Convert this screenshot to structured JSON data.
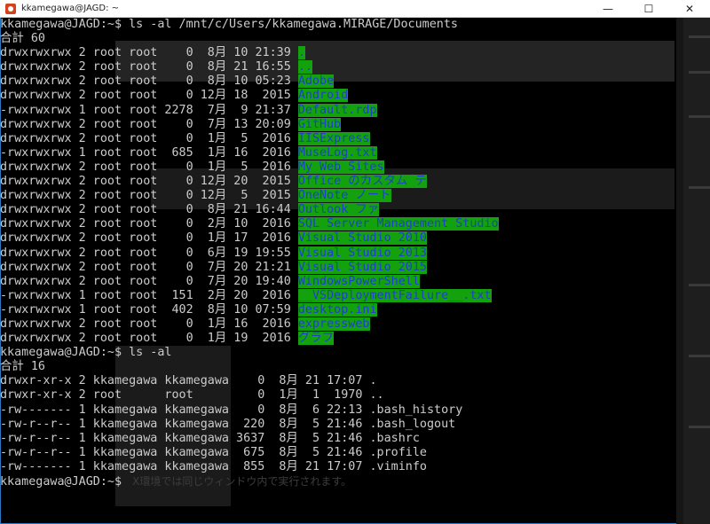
{
  "window": {
    "title": "kkamegawa@JAGD: ~",
    "controls": {
      "minimize": "—",
      "maximize": "☐",
      "close": "✕"
    }
  },
  "terminal": {
    "lines": [
      {
        "prefix": "kkamegawa@JAGD:~$ ls -al /mnt/c/Users/kkamegawa.MIRAGE/Documents",
        "name": ""
      },
      {
        "prefix": "合計 60",
        "name": ""
      },
      {
        "prefix": "drwxrwxrwx 2 root root    0  8月 10 21:39 ",
        "name": "."
      },
      {
        "prefix": "drwxrwxrwx 2 root root    0  8月 21 16:55 ",
        "name": ".."
      },
      {
        "prefix": "drwxrwxrwx 2 root root    0  8月 10 05:23 ",
        "name": "Adobe"
      },
      {
        "prefix": "drwxrwxrwx 2 root root    0 12月 18  2015 ",
        "name": "Android"
      },
      {
        "prefix": "-rwxrwxrwx 1 root root 2278  7月  9 21:37 ",
        "name": "Default.rdp"
      },
      {
        "prefix": "drwxrwxrwx 2 root root    0  7月 13 20:09 ",
        "name": "GitHub"
      },
      {
        "prefix": "drwxrwxrwx 2 root root    0  1月  5  2016 ",
        "name": "IISExpress"
      },
      {
        "prefix": "-rwxrwxrwx 1 root root  685  1月 16  2016 ",
        "name": "MuseLog.txt"
      },
      {
        "prefix": "drwxrwxrwx 2 root root    0  1月  5  2016 ",
        "name": "My Web Sites"
      },
      {
        "prefix": "drwxrwxrwx 2 root root    0 12月 20  2015 ",
        "name": "Office のカスタム テ"
      },
      {
        "prefix": "drwxrwxrwx 2 root root    0 12月  5  2015 ",
        "name": "OneNote ノート"
      },
      {
        "prefix": "drwxrwxrwx 2 root root    0  8月 21 16:44 ",
        "name": "Outlook ファ"
      },
      {
        "prefix": "drwxrwxrwx 2 root root    0  2月 10  2016 ",
        "name": "SQL Server Management Studio"
      },
      {
        "prefix": "drwxrwxrwx 2 root root    0  1月 17  2016 ",
        "name": "Visual Studio 2010"
      },
      {
        "prefix": "drwxrwxrwx 2 root root    0  6月 19 19:55 ",
        "name": "Visual Studio 2013"
      },
      {
        "prefix": "drwxrwxrwx 2 root root    0  7月 20 21:21 ",
        "name": "Visual Studio 2015"
      },
      {
        "prefix": "drwxrwxrwx 2 root root    0  7月 20 19:40 ",
        "name": "WindowsPowerShell"
      },
      {
        "prefix": "-rwxrwxrwx 1 root root  151  2月 20  2016 ",
        "name": "__VSDeploymentFailure__.txt"
      },
      {
        "prefix": "-rwxrwxrwx 1 root root  402  8月 10 07:59 ",
        "name": "desktop.ini"
      },
      {
        "prefix": "drwxrwxrwx 2 root root    0  1月 16  2016 ",
        "name": "expressweb"
      },
      {
        "prefix": "drwxrwxrwx 2 root root    0  1月 19  2016 ",
        "name": "グラフ"
      },
      {
        "prefix": "kkamegawa@JAGD:~$ ls -al",
        "name": ""
      },
      {
        "prefix": "合計 16",
        "name": ""
      },
      {
        "prefix": "drwxr-xr-x 2 kkamegawa kkamegawa    0  8月 21 17:07 .",
        "name": ""
      },
      {
        "prefix": "drwxr-xr-x 2 root      root         0  1月  1  1970 ..",
        "name": ""
      },
      {
        "prefix": "-rw------- 1 kkamegawa kkamegawa    0  8月  6 22:13 .bash_history",
        "name": ""
      },
      {
        "prefix": "-rw-r--r-- 1 kkamegawa kkamegawa  220  8月  5 21:46 .bash_logout",
        "name": ""
      },
      {
        "prefix": "-rw-r--r-- 1 kkamegawa kkamegawa 3637  8月  5 21:46 .bashrc",
        "name": ""
      },
      {
        "prefix": "-rw-r--r-- 1 kkamegawa kkamegawa  675  8月  5 21:46 .profile",
        "name": ""
      },
      {
        "prefix": "-rw------- 1 kkamegawa kkamegawa  855  8月 21 17:07 .viminfo",
        "name": ""
      },
      {
        "prefix": "kkamegawa@JAGD:~$ ",
        "name": ""
      }
    ],
    "ghost_text": "X環境では同じウィンドウ内で実行されます。",
    "colors": {
      "background": "#000000",
      "foreground": "#cccccc",
      "highlight_bg": "#13a10e",
      "highlight_fg": "#1d41cc"
    }
  }
}
